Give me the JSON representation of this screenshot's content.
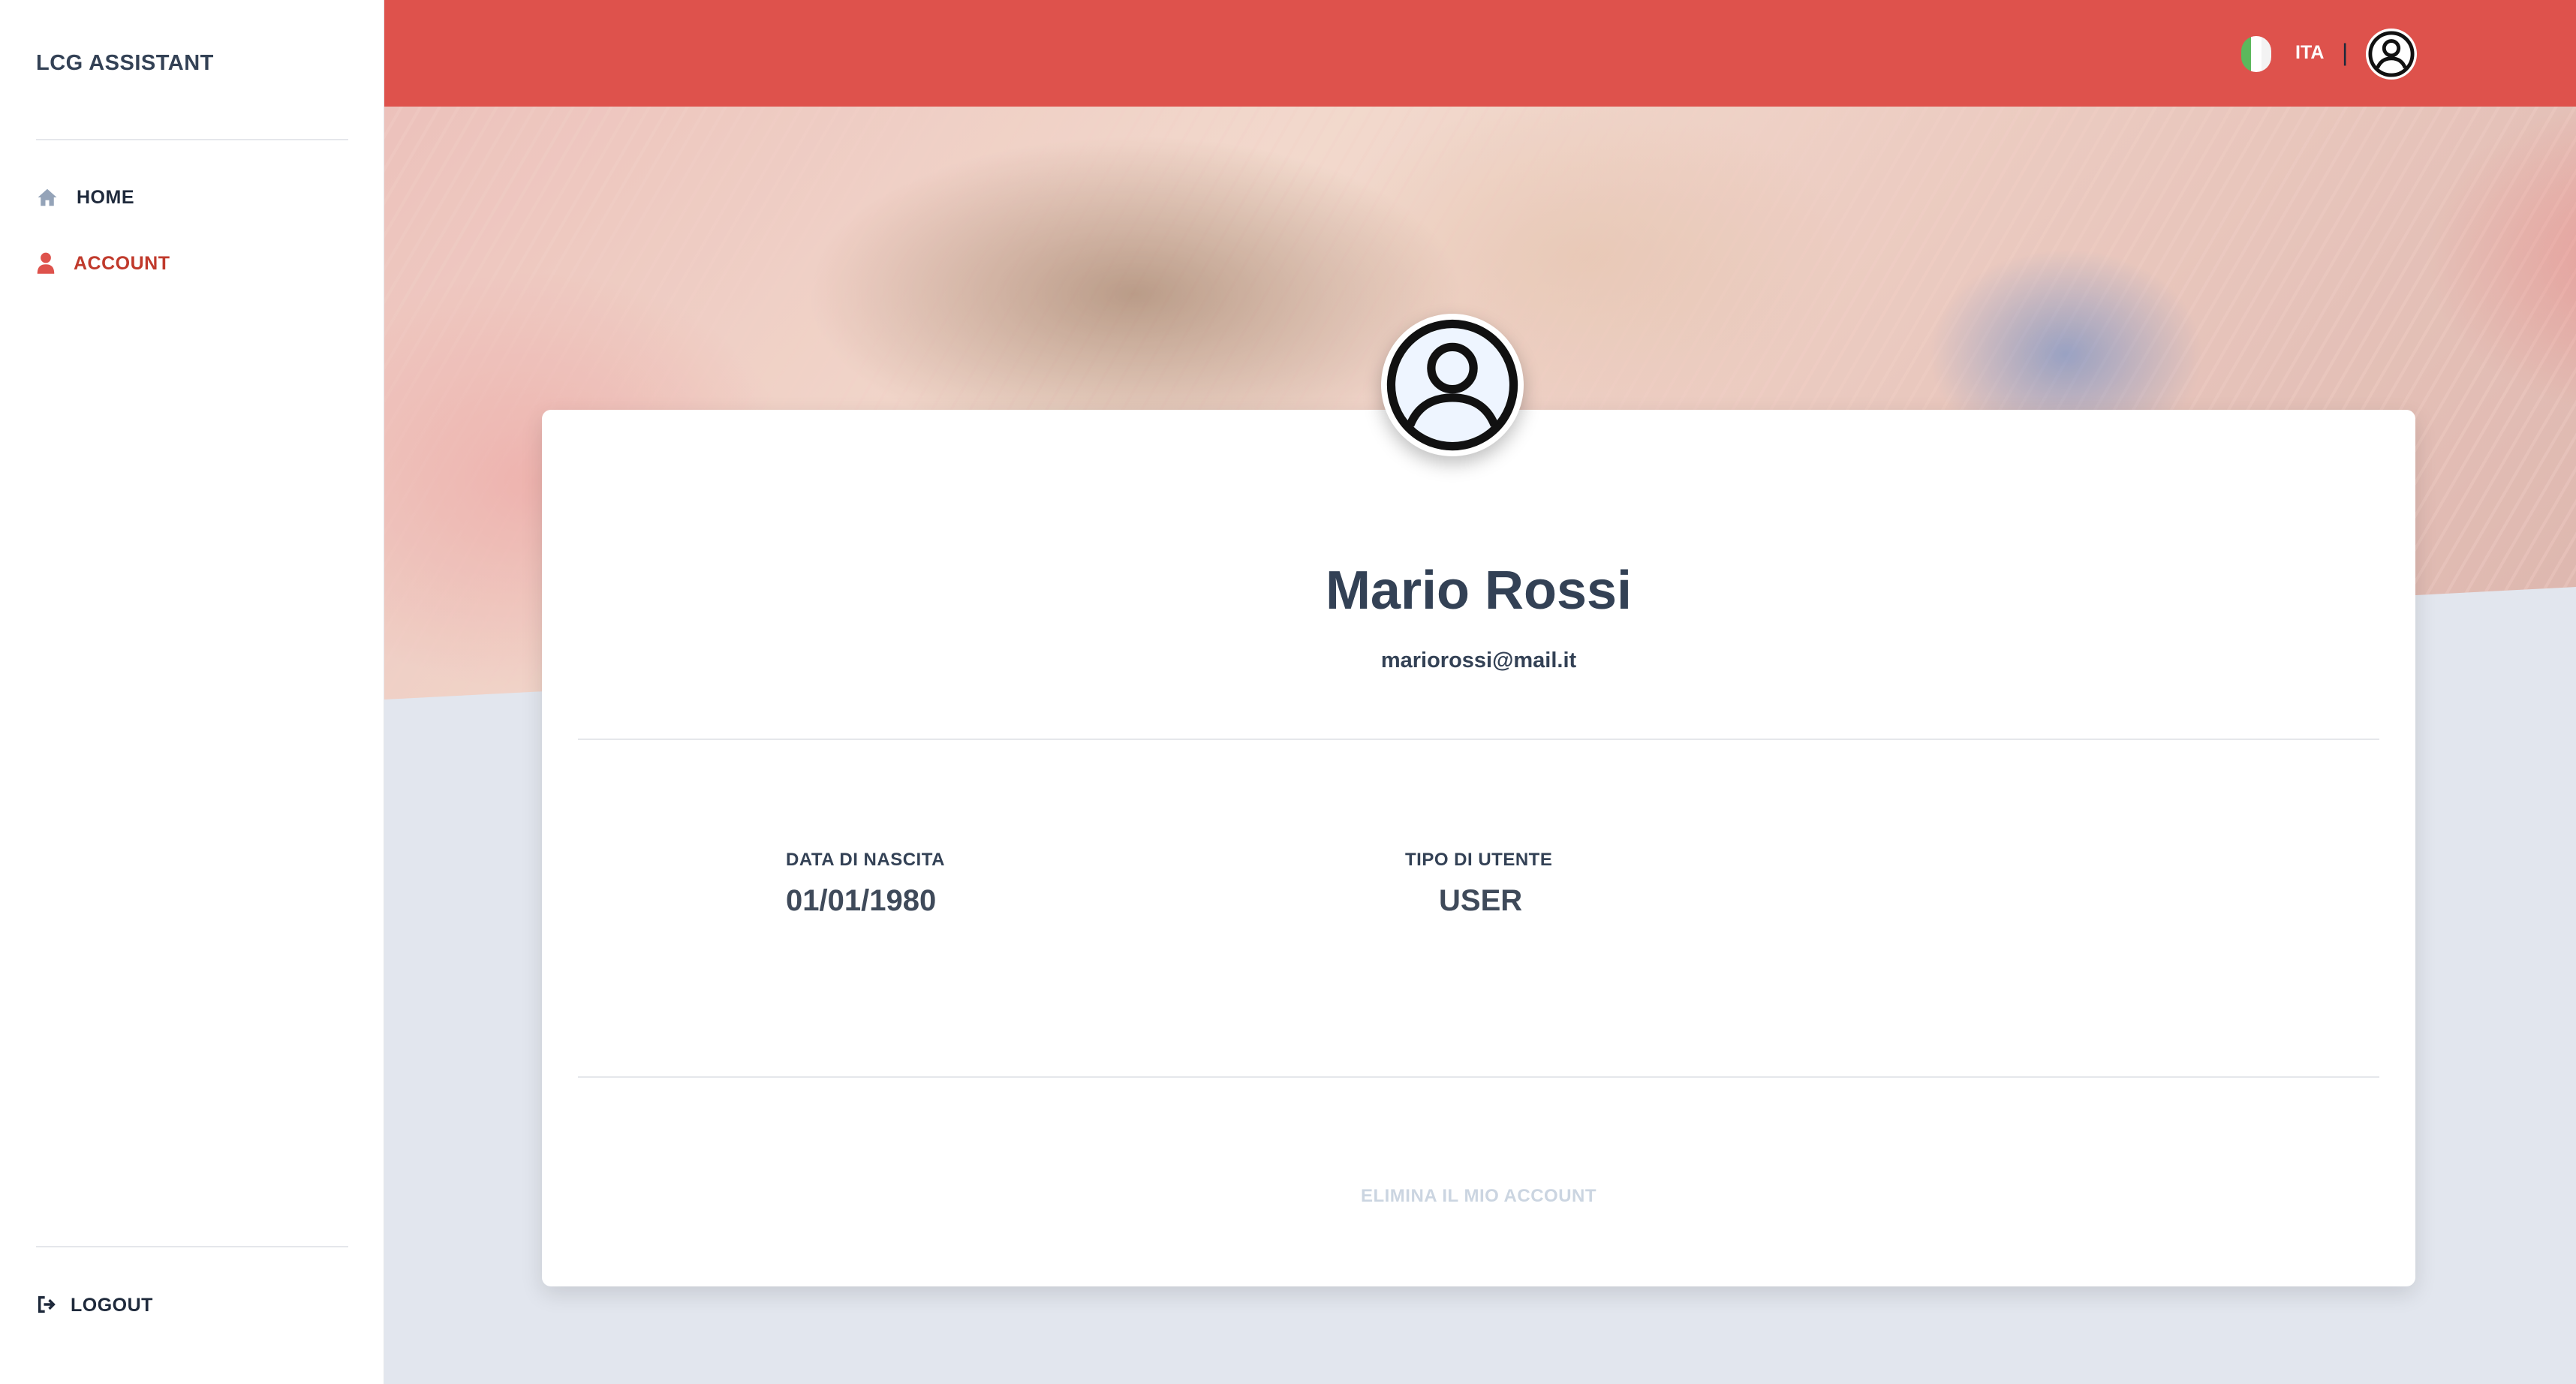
{
  "app": {
    "brand": "LCG ASSISTANT"
  },
  "sidebar": {
    "items": [
      {
        "label": "HOME",
        "icon": "home-icon",
        "active": false
      },
      {
        "label": "ACCOUNT",
        "icon": "user-icon",
        "active": true
      }
    ],
    "logout_label": "LOGOUT",
    "logout_icon": "sign-out-icon"
  },
  "topbar": {
    "language_label": "ITA",
    "separator": "|",
    "flag_colors": [
      "#5cb85c",
      "#ffffff",
      "#e74c3c"
    ],
    "avatar_icon": "user-circle-icon"
  },
  "profile": {
    "name": "Mario Rossi",
    "email": "mariorossi@mail.it",
    "avatar_icon": "user-circle-icon",
    "fields": [
      {
        "label": "DATA DI NASCITA",
        "value": "01/01/1980"
      },
      {
        "label": "TIPO DI UTENTE",
        "value": "USER"
      }
    ],
    "delete_label": "ELIMINA IL MIO ACCOUNT"
  },
  "colors": {
    "accent": "#de524c",
    "active_nav": "#c0392b",
    "text_dark": "#334155",
    "page_bg": "#e2e6ee"
  }
}
